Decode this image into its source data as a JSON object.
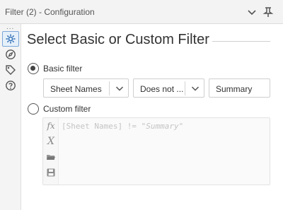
{
  "window": {
    "title": "Filter (2) - Configuration",
    "collapse_icon": "chevron-down-icon",
    "pin_icon": "pin-icon"
  },
  "sidebar": {
    "overflow": "...",
    "items": [
      {
        "icon": "gear-icon",
        "active": true
      },
      {
        "icon": "compass-icon",
        "active": false
      },
      {
        "icon": "tag-icon",
        "active": false
      },
      {
        "icon": "help-icon",
        "active": false
      }
    ]
  },
  "heading": "Select Basic or Custom Filter",
  "basic": {
    "label": "Basic filter",
    "selected": true,
    "field_value": "Sheet Names",
    "operator_value": "Does not ...",
    "value": "Summary"
  },
  "custom": {
    "label": "Custom filter",
    "selected": false,
    "expression_field": "[Sheet Names]",
    "expression_operator": " != ",
    "expression_value": "\"Summary\"",
    "tools": [
      {
        "label": "fx",
        "icon": "function-icon"
      },
      {
        "label": "X",
        "icon": "variable-icon"
      },
      {
        "icon": "open-folder-icon"
      },
      {
        "icon": "save-icon"
      }
    ]
  },
  "colors": {
    "accent": "#2d6db4",
    "active_bg": "#e6f0fa"
  }
}
